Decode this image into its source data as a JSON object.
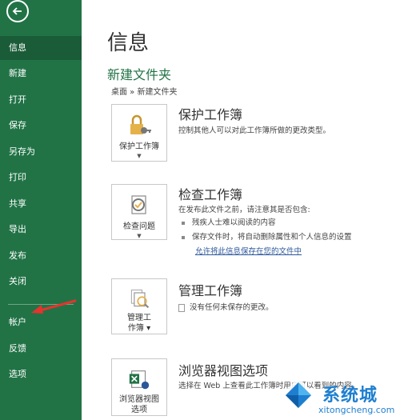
{
  "sidebar": {
    "items": [
      {
        "label": "信息",
        "active": true
      },
      {
        "label": "新建"
      },
      {
        "label": "打开"
      },
      {
        "label": "保存"
      },
      {
        "label": "另存为"
      },
      {
        "label": "打印"
      },
      {
        "label": "共享"
      },
      {
        "label": "导出"
      },
      {
        "label": "发布"
      },
      {
        "label": "关闭"
      },
      {
        "label": "帐户"
      },
      {
        "label": "反馈"
      },
      {
        "label": "选项"
      }
    ]
  },
  "main": {
    "title": "信息",
    "doc_name": "新建文件夹",
    "breadcrumb": "桌面 » 新建文件夹",
    "sections": [
      {
        "button_label": "保护工作簿",
        "title": "保护工作簿",
        "desc": "控制其他人可以对此工作簿所做的更改类型。"
      },
      {
        "button_label": "检查问题",
        "title": "检查工作簿",
        "desc": "在发布此文件之前，请注意其是否包含:",
        "bullets": [
          "残疾人士难以阅读的内容",
          "保存文件时，将自动删除属性和个人信息的设置"
        ],
        "link": "允许将此信息保存在您的文件中"
      },
      {
        "button_label_1": "管理工",
        "button_label_2": "作簿",
        "title": "管理工作簿",
        "desc": "没有任何未保存的更改。"
      },
      {
        "button_label_1": "浏览器视图",
        "button_label_2": "选项",
        "title": "浏览器视图选项",
        "desc": "选择在 Web 上查看此工作簿时用户可以看到的内容。"
      }
    ]
  },
  "watermark": {
    "title": "系统城",
    "url": "xitongcheng.com"
  },
  "colors": {
    "sidebar": "#217346",
    "sidebar_active": "#1a5c38",
    "accent": "#217346",
    "link": "#2b579a",
    "annotation": "#e8322d"
  }
}
